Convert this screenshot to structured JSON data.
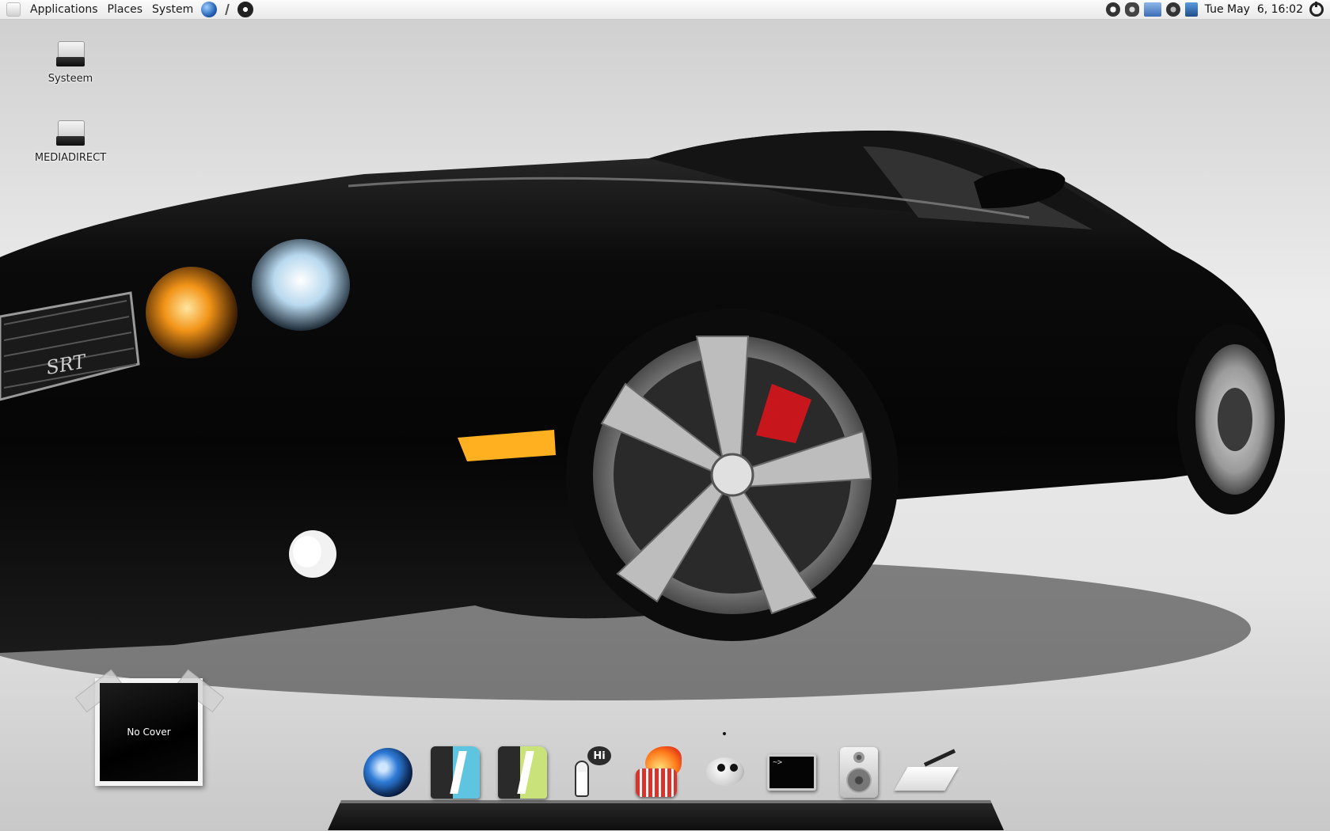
{
  "top_panel": {
    "menus": [
      "Applications",
      "Places",
      "System"
    ],
    "launchers": [
      "globe-icon",
      "separator-icon",
      "lifebuoy-icon"
    ],
    "tray_icons": [
      "network-icon",
      "update-icon",
      "display-icon",
      "bluetooth-icon",
      "volume-icon"
    ],
    "clock": "Tue May  6, 16:02",
    "power": "power-icon"
  },
  "desktop_icons": [
    {
      "label": "Systeem",
      "icon": "drive-icon"
    },
    {
      "label": "MEDIADIRECT",
      "icon": "drive-icon"
    }
  ],
  "cover_widget": {
    "text": "No Cover"
  },
  "dock": {
    "items": [
      {
        "name": "web-browser",
        "icon": "browser-icon"
      },
      {
        "name": "text-document",
        "icon": "writer-icon"
      },
      {
        "name": "spreadsheet",
        "icon": "calc-icon"
      },
      {
        "name": "chat",
        "icon": "chat-icon",
        "badge": "Hi"
      },
      {
        "name": "disc-burner",
        "icon": "burner-icon"
      },
      {
        "name": "image-editor",
        "icon": "gimp-icon"
      },
      {
        "name": "terminal",
        "icon": "terminal-icon",
        "prompt": "~>"
      },
      {
        "name": "music-player",
        "icon": "speaker-icon"
      },
      {
        "name": "text-editor",
        "icon": "editor-icon"
      }
    ]
  },
  "colors": {
    "car_body": "#0a0a0a",
    "brake_caliper": "#c8161d",
    "indicator": "#ffb020",
    "headlight_amber": "#f29418"
  }
}
